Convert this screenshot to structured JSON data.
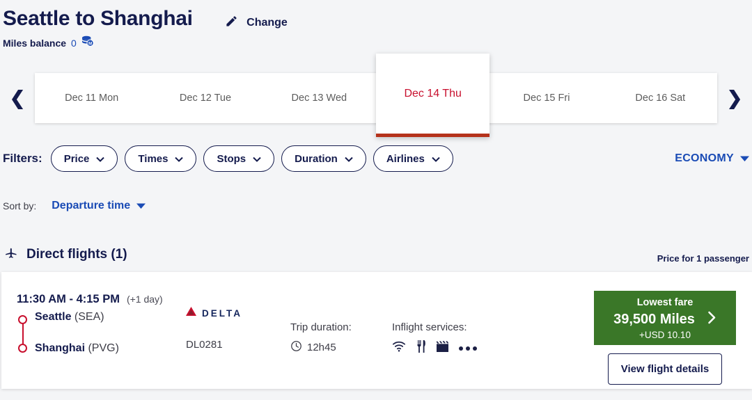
{
  "header": {
    "route_title": "Seattle to Shanghai",
    "change_label": "Change",
    "change_icon": "pencil-icon",
    "miles_balance_label": "Miles balance",
    "miles_balance_value": "0",
    "miles_icon": "miles-coins-icon"
  },
  "date_strip": {
    "prev_icon": "chevron-left-icon",
    "next_icon": "chevron-right-icon",
    "dates": [
      {
        "label": "Dec 11 Mon",
        "active": false
      },
      {
        "label": "Dec 12 Tue",
        "active": false
      },
      {
        "label": "Dec 13 Wed",
        "active": false
      },
      {
        "label": "Dec 14 Thu",
        "active": true
      },
      {
        "label": "Dec 15 Fri",
        "active": false
      },
      {
        "label": "Dec 16 Sat",
        "active": false
      }
    ]
  },
  "filters": {
    "label": "Filters:",
    "chips": [
      {
        "label": "Price"
      },
      {
        "label": "Times"
      },
      {
        "label": "Stops"
      },
      {
        "label": "Duration"
      },
      {
        "label": "Airlines"
      }
    ],
    "cabin": "ECONOMY"
  },
  "sort": {
    "label": "Sort by:",
    "value": "Departure time"
  },
  "results": {
    "section_icon": "airplane-icon",
    "section_title": "Direct flights (1)",
    "passenger_note": "Price for 1 passenger"
  },
  "flight": {
    "times": "11:30 AM - 4:15 PM",
    "day_offset": "(+1 day)",
    "origin_city": "Seattle",
    "origin_code": "(SEA)",
    "destination_city": "Shanghai",
    "destination_code": "(PVG)",
    "airline_name": "DELTA",
    "airline_logo": "delta-triangle-icon",
    "flight_number": "DL0281",
    "duration_label": "Trip duration:",
    "duration_value": "12h45",
    "duration_icon": "clock-icon",
    "services_label": "Inflight services:",
    "service_icons": [
      "wifi-icon",
      "meal-icon",
      "entertainment-icon",
      "more-icon"
    ],
    "fare_label": "Lowest fare",
    "fare_miles": "39,500 Miles",
    "fare_taxes": "+USD 10.10",
    "fare_arrow": "chevron-right-icon",
    "details_label": "View flight details"
  },
  "colors": {
    "navy": "#141b4d",
    "blue_link": "#1a4bb5",
    "red": "#c8102e",
    "green": "#3a7728",
    "page_bg": "#f4f5f7"
  }
}
